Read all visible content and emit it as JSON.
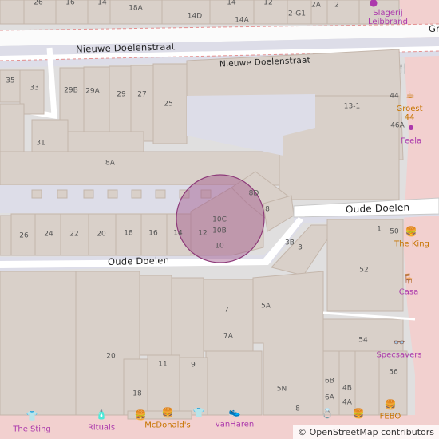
{
  "roads": {
    "nieuwe_doelenstraat_1": "Nieuwe Doelenstraat",
    "nieuwe_doelenstraat_2": "Nieuwe Doelenstraat",
    "oude_doelen_1": "Oude Doelen",
    "oude_doelen_2": "Oude Doelen",
    "gr_partial": "Gr"
  },
  "house_numbers": [
    "26",
    "16",
    "14",
    "12",
    "18A",
    "14D",
    "14A",
    "2-G1",
    "2A",
    "2",
    "35",
    "33",
    "29B",
    "29A",
    "29",
    "27",
    "25",
    "31",
    "8A",
    "8D",
    "8",
    "10C",
    "10B",
    "10",
    "14",
    "12",
    "16",
    "18",
    "20",
    "22",
    "24",
    "26",
    "3B",
    "3",
    "1",
    "50",
    "52",
    "13-1",
    "44",
    "46A",
    "7",
    "5A",
    "7A",
    "20",
    "11",
    "9",
    "54",
    "56",
    "6B",
    "6A",
    "4B",
    "4A",
    "5N",
    "8",
    "18"
  ],
  "pois": [
    {
      "name": "Slagerij Leibbrand",
      "icon": "person-icon",
      "color": "#ac39ac"
    },
    {
      "name": "Groest 44",
      "icon": "cafe-icon",
      "color": "#c77400"
    },
    {
      "name": "Feela",
      "icon": "dot-icon",
      "color": "#ac39ac"
    },
    {
      "name": "The King",
      "icon": "fast-food-icon",
      "color": "#c77400"
    },
    {
      "name": "Casa",
      "icon": "furniture-icon",
      "color": "#ac39ac"
    },
    {
      "name": "Specsavers",
      "icon": "optician-icon",
      "color": "#ac39ac"
    },
    {
      "name": "FEBO",
      "icon": "fast-food-icon",
      "color": "#c77400"
    },
    {
      "name": "The Sting",
      "icon": "clothes-icon",
      "color": "#ac39ac"
    },
    {
      "name": "Rituals",
      "icon": "perfume-icon",
      "color": "#ac39ac"
    },
    {
      "name": "McDonald's",
      "icon": "fast-food-icon",
      "color": "#c77400"
    },
    {
      "name": "vanHaren",
      "icon": "shoe-icon",
      "color": "#ac39ac"
    }
  ],
  "attribution": "© OpenStreetMap contributors",
  "colors": {
    "building": "#d9d0c9",
    "building_outline": "#c4b6ab",
    "pedestrian": "#dddde8",
    "road": "#ffffff",
    "boundary_pink": "#f2c7c7",
    "shop": "#ac39ac",
    "food": "#c77400",
    "highlight": "#a0558a"
  }
}
